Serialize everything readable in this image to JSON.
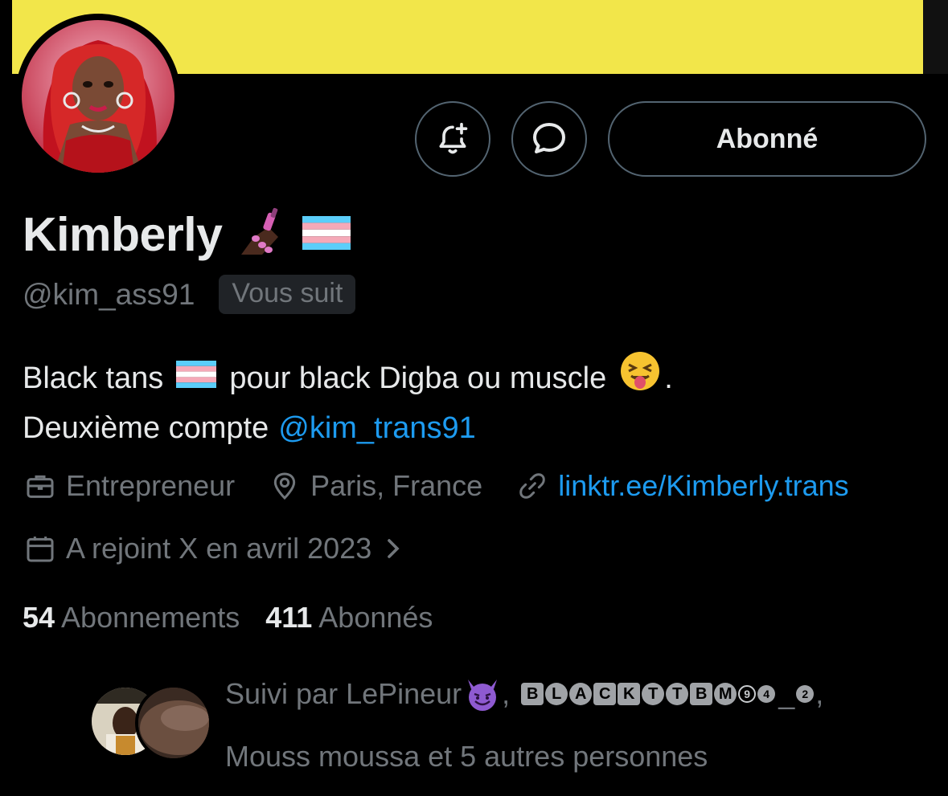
{
  "profile": {
    "display_name": "Kimberly",
    "handle": "@kim_ass91",
    "follows_you_badge": "Vous suit",
    "verified_emojis": [
      "nail-polish-emoji",
      "transgender-flag-emoji"
    ]
  },
  "actions": {
    "follow_button_label": "Abonné",
    "notify_icon": "bell-plus-icon",
    "message_icon": "message-bubble-icon"
  },
  "bio": {
    "line1_part1": "Black tans",
    "line1_part2": "pour black Digba ou muscle",
    "line1_end": ".",
    "line2_text": "Deuxième compte",
    "line2_mention": "@kim_trans91"
  },
  "meta": {
    "profession": "Entrepreneur",
    "location": "Paris, France",
    "website": "linktr.ee/Kimberly.trans",
    "joined": "A rejoint X en avril 2023"
  },
  "stats": {
    "following_count": "54",
    "following_label": "Abonnements",
    "followers_count": "411",
    "followers_label": "Abonnés"
  },
  "followed_by": {
    "prefix": "Suivi par LePineur",
    "separator": ",",
    "second_name_glyphs": [
      "B",
      "L",
      "A",
      "C",
      "K",
      "T",
      "T",
      "B",
      "M",
      "9",
      "4",
      "_",
      "2"
    ],
    "line2": "Mouss moussa et 5 autres personnes"
  },
  "colors": {
    "banner": "#f2e64a",
    "accent_link": "#1d9bf0",
    "muted_text": "#71767b",
    "primary_text": "#e7e9ea",
    "border": "#536471"
  }
}
